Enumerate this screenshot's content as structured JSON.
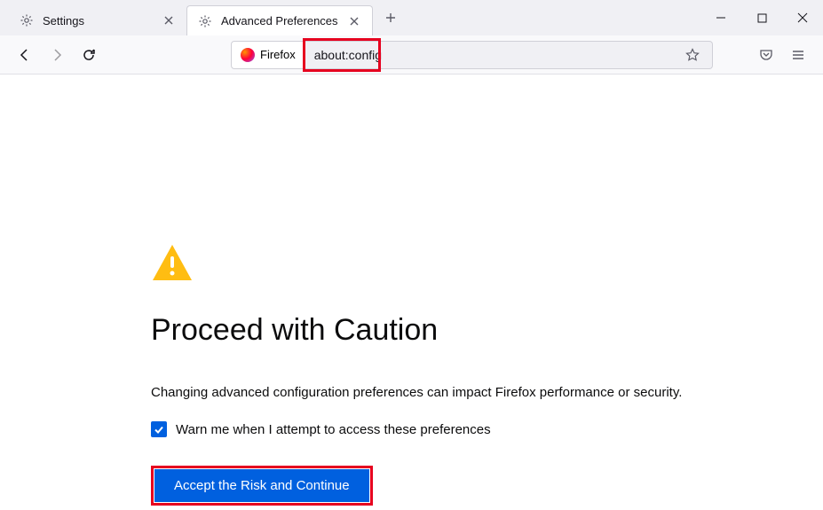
{
  "tabs": [
    {
      "label": "Settings",
      "active": false
    },
    {
      "label": "Advanced Preferences",
      "active": true
    }
  ],
  "identity": {
    "label": "Firefox"
  },
  "urlbar": {
    "value": "about:config"
  },
  "page": {
    "title": "Proceed with Caution",
    "description": "Changing advanced configuration preferences can impact Firefox performance or security.",
    "checkbox_label": "Warn me when I attempt to access these preferences",
    "checkbox_checked": true,
    "accept_label": "Accept the Risk and Continue"
  }
}
